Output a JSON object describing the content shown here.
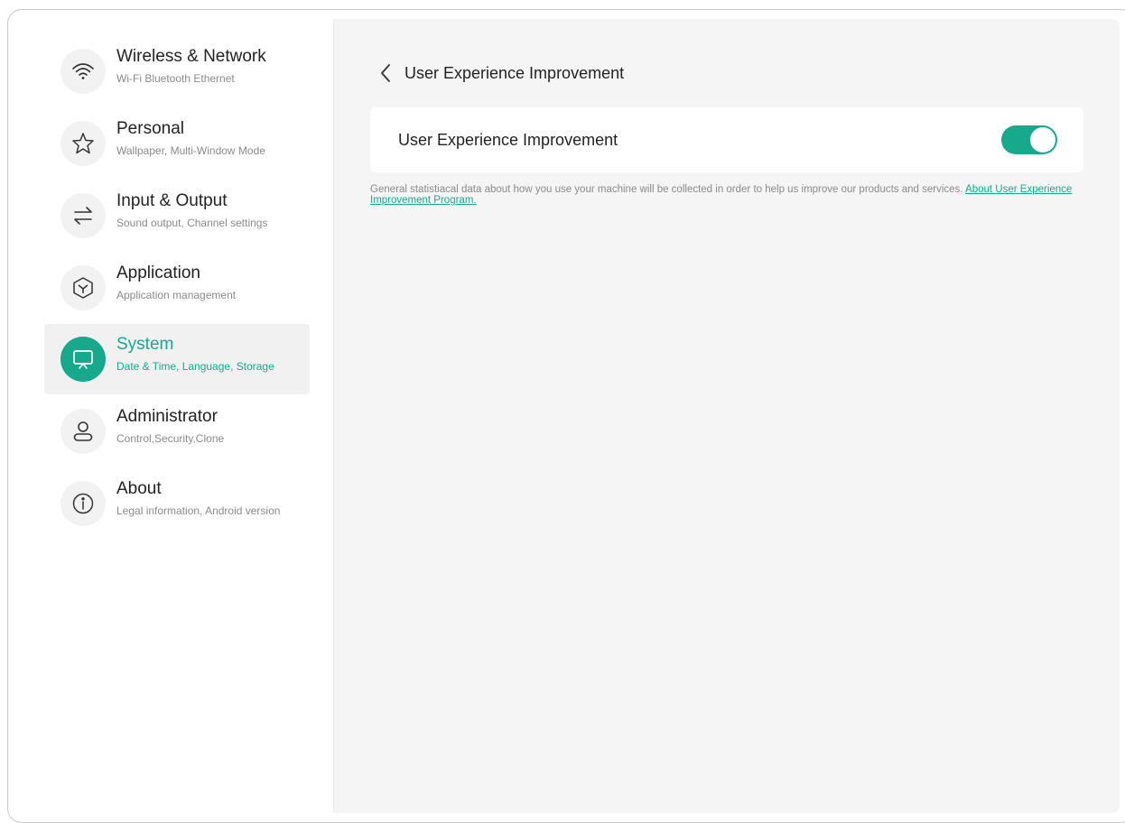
{
  "sidebar": {
    "items": [
      {
        "title": "Wireless & Network",
        "subtitle": "Wi-Fi Bluetooth Ethernet",
        "icon": "wifi-icon",
        "active": false
      },
      {
        "title": "Personal",
        "subtitle": "Wallpaper, Multi-Window Mode",
        "icon": "star-icon",
        "active": false
      },
      {
        "title": "Input & Output",
        "subtitle": "Sound output, Channel settings",
        "icon": "swap-arrows-icon",
        "active": false
      },
      {
        "title": "Application",
        "subtitle": "Application management",
        "icon": "cube-icon",
        "active": false
      },
      {
        "title": "System",
        "subtitle": "Date & Time, Language, Storage",
        "icon": "display-icon",
        "active": true
      },
      {
        "title": "Administrator",
        "subtitle": "Control,Security,Clone",
        "icon": "user-icon",
        "active": false
      },
      {
        "title": "About",
        "subtitle": "Legal information, Android version",
        "icon": "info-icon",
        "active": false
      }
    ]
  },
  "main": {
    "title": "User Experience Improvement",
    "setting": {
      "label": "User Experience Improvement",
      "enabled": true
    },
    "description": {
      "text": "General statistiacal data about how you use your machine will be collected in order to help us improve our products and services. ",
      "link": "About User Experience Improvement Program."
    }
  },
  "colors": {
    "accent": "#17a98c",
    "sidebar_active_bg": "#f1f1f1",
    "content_bg": "#f5f5f5"
  }
}
